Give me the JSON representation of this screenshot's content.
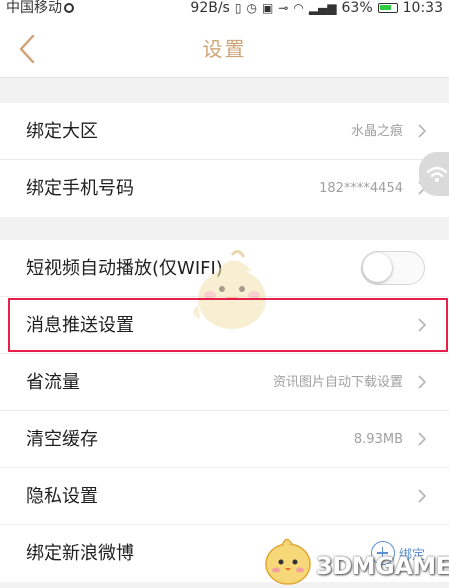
{
  "status_bar": {
    "carrier": "中国移动",
    "speed": "92B/s",
    "battery": "63%",
    "time": "10:33"
  },
  "nav": {
    "title": "设置",
    "back_icon": "chevron-left-icon",
    "accent_color": "#cfa57a"
  },
  "group1": [
    {
      "label": "绑定大区",
      "value": "水晶之痕"
    },
    {
      "label": "绑定手机号码",
      "value": "182****4454"
    }
  ],
  "group2": [
    {
      "label": "短视频自动播放(仅WIFI)",
      "toggle_on": false
    },
    {
      "label": "消息推送设置",
      "value": ""
    },
    {
      "label": "省流量",
      "value": "资讯图片自动下载设置"
    },
    {
      "label": "清空缓存",
      "value": "8.93MB"
    },
    {
      "label": "隐私设置",
      "value": ""
    },
    {
      "label": "绑定新浪微博",
      "action": "绑定"
    }
  ],
  "watermark": {
    "text": "3DMGAME"
  },
  "highlight_color": "#e5214b"
}
